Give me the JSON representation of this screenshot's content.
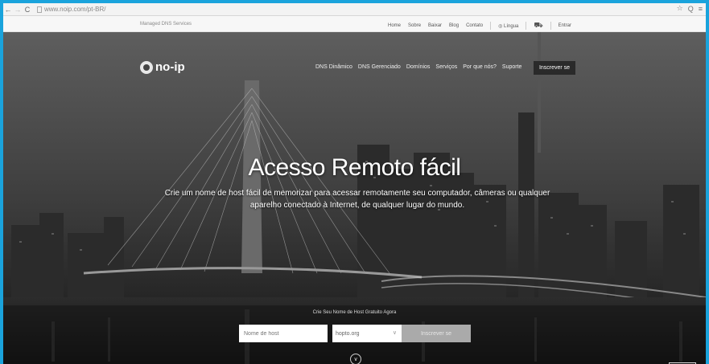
{
  "browser": {
    "url": "www.noip.com/pt-BR/",
    "back_icon": "back-arrow-icon",
    "forward_icon": "forward-arrow-icon",
    "reload_icon": "reload-icon",
    "right_icons": [
      "☆",
      "Q",
      "≡"
    ]
  },
  "topbar": {
    "tagline": "Managed DNS Services",
    "links": [
      "Home",
      "Sobre",
      "Baixar",
      "Blog",
      "Contato"
    ],
    "language": "Língua",
    "cart_icon": "cart-icon",
    "signin": "Entrar"
  },
  "header": {
    "logo_text": "no-ip",
    "nav": [
      "DNS Dinâmico",
      "DNS Gerenciado",
      "Domínios",
      "Serviços",
      "Por que nós?",
      "Suporte"
    ],
    "signup": "Inscrever se"
  },
  "hero": {
    "title": "Acesso Remoto fácil",
    "subtitle": "Crie um nome de host fácil de memorizar para acessar remotamente seu computador, câmeras ou qualquer aparelho conectado à Internet, de qualquer lugar do mundo."
  },
  "form": {
    "title": "Crie Seu Nome de Host Gratuito Agora",
    "host_placeholder": "Nome de host",
    "domain_value": "hopto.org",
    "submit": "Inscrever se"
  },
  "colors": {
    "outer_border": "#1aa3dc",
    "signup_nav_bg": "#2a2a2a",
    "submit_bg": "#aaaaaa"
  }
}
